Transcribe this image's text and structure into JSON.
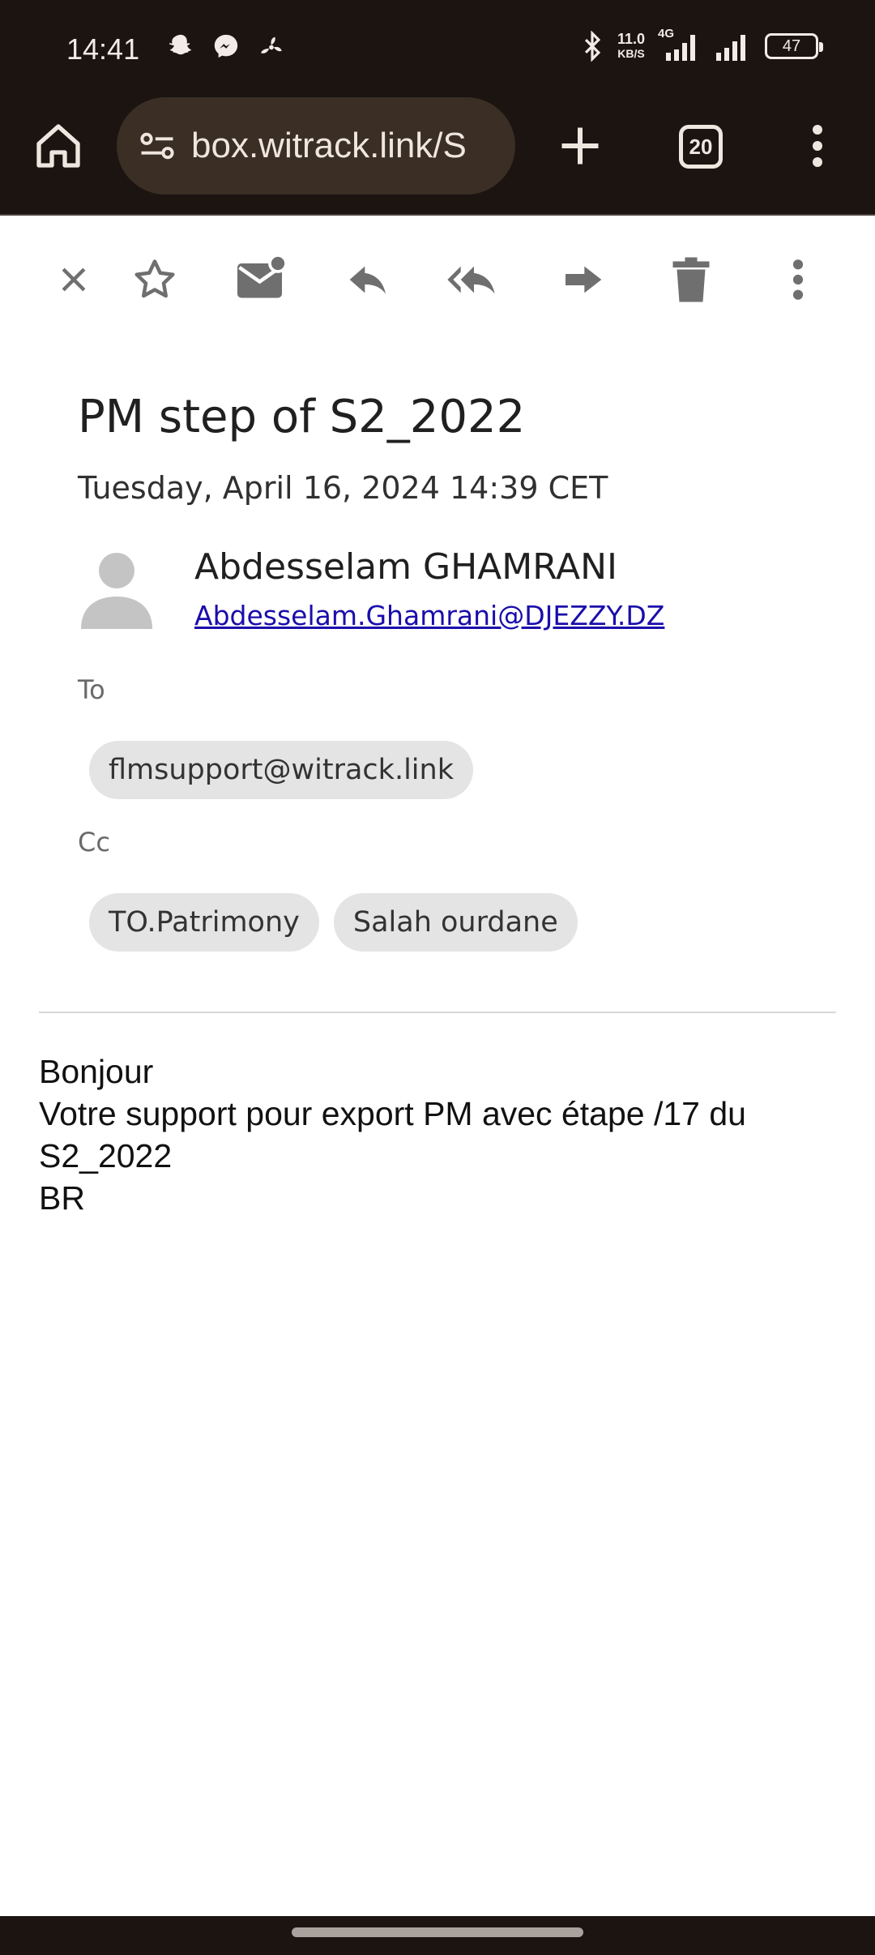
{
  "status_bar": {
    "time": "14:41",
    "net_speed": "11.0",
    "net_unit": "KB/S",
    "network": "4G",
    "battery": "47",
    "icons_left": [
      "snapchat-icon",
      "messenger-icon",
      "fan-icon"
    ],
    "icons_right": [
      "bluetooth-icon",
      "signal-icon",
      "signal-icon"
    ]
  },
  "browser": {
    "url": "box.witrack.link/S",
    "tab_count": "20"
  },
  "email": {
    "subject": "PM step of S2_2022",
    "date": "Tuesday, April 16, 2024 14:39 CET",
    "sender_name": "Abdesselam GHAMRANI",
    "sender_email": "Abdesselam.Ghamrani@DJEZZY.DZ",
    "to_label": "To",
    "to": [
      "flmsupport@witrack.link"
    ],
    "cc_label": "Cc",
    "cc": [
      "TO.Patrimony",
      "Salah ourdane"
    ],
    "body_lines": [
      "Bonjour",
      "Votre support pour export PM avec étape /17 du",
      "S2_2022",
      "BR"
    ]
  },
  "actions": [
    "close-icon",
    "star-icon",
    "mark-unread-icon",
    "reply-icon",
    "reply-all-icon",
    "forward-icon",
    "delete-icon",
    "more-icon"
  ],
  "colors": {
    "chrome_bg": "#1b1410",
    "url_bg": "#3b2e25",
    "icon_gray": "#6f6f6f",
    "chip_bg": "#e4e4e4",
    "link": "#1a0dab"
  }
}
